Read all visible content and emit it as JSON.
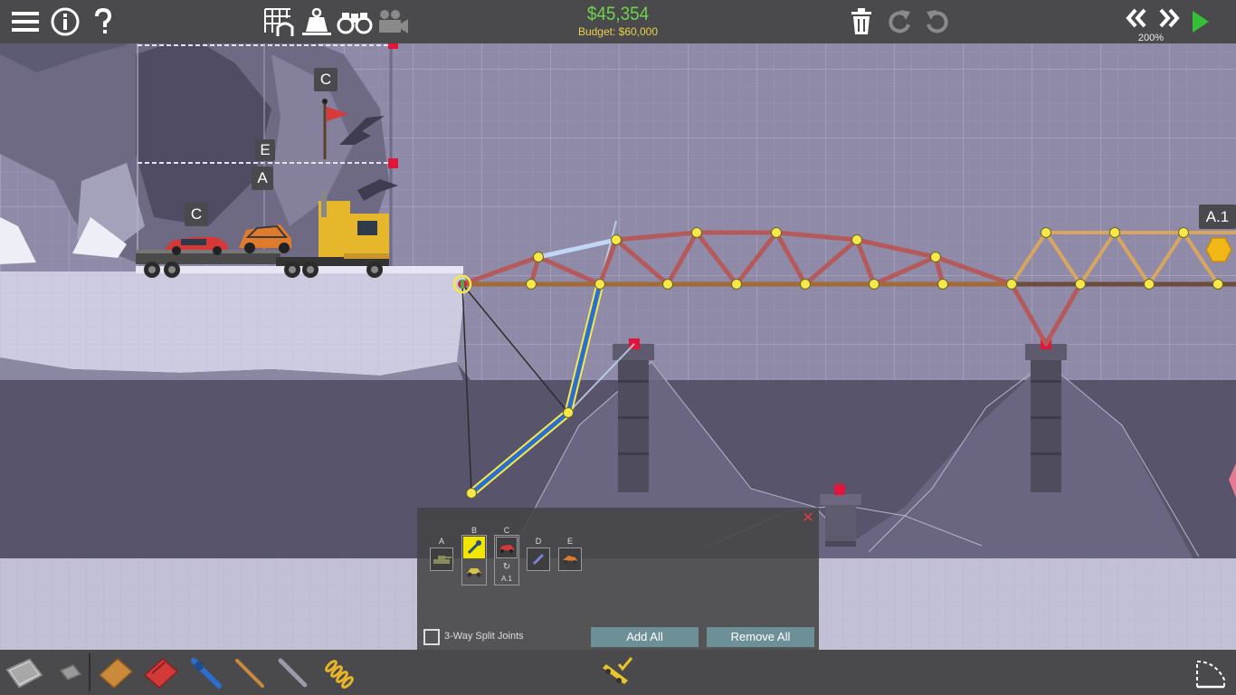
{
  "toolbar": {
    "left_icons": [
      "menu-icon",
      "info-icon",
      "help-icon"
    ],
    "view_icons": [
      "grid-snap-icon",
      "weight-icon",
      "binoculars-icon",
      "camera-icon"
    ],
    "edit_icons": [
      "trash-icon",
      "redo-icon",
      "undo-icon"
    ],
    "playback_icons": [
      "rewind-icon",
      "fast-forward-icon",
      "play-icon"
    ]
  },
  "cost": {
    "current": "$45,354",
    "budget": "Budget: $60,000"
  },
  "simulation_speed": "200%",
  "scene_signs": {
    "upper_c": "C",
    "e": "E",
    "a": "A",
    "lower_c": "C",
    "a1": "A.1"
  },
  "vehicle_panel": {
    "columns": [
      {
        "label": "A",
        "vehicle": "tank"
      },
      {
        "label": "B",
        "vehicle": "wrench",
        "selected": true,
        "second_vehicle": "dune-buggy"
      },
      {
        "label": "C",
        "vehicle": "red-car",
        "caption": "A.1"
      },
      {
        "label": "D",
        "vehicle": "blue-car"
      },
      {
        "label": "E",
        "vehicle": "orange-buggy"
      }
    ],
    "split_joints_label": "3-Way Split Joints",
    "add_all": "Add All",
    "remove_all": "Remove All"
  },
  "materials": [
    "road",
    "reinforced-road",
    "wood",
    "steel",
    "hydraulic",
    "rope",
    "cable",
    "spring"
  ],
  "colors": {
    "background": "#8e8aa8",
    "bar": "#4a4a4c",
    "steel": "#b55a5a",
    "wood": "#d8a65e",
    "hydraulic": "#2a6fcf",
    "joint": "#f7e84a",
    "anchor": "#e0153a"
  }
}
